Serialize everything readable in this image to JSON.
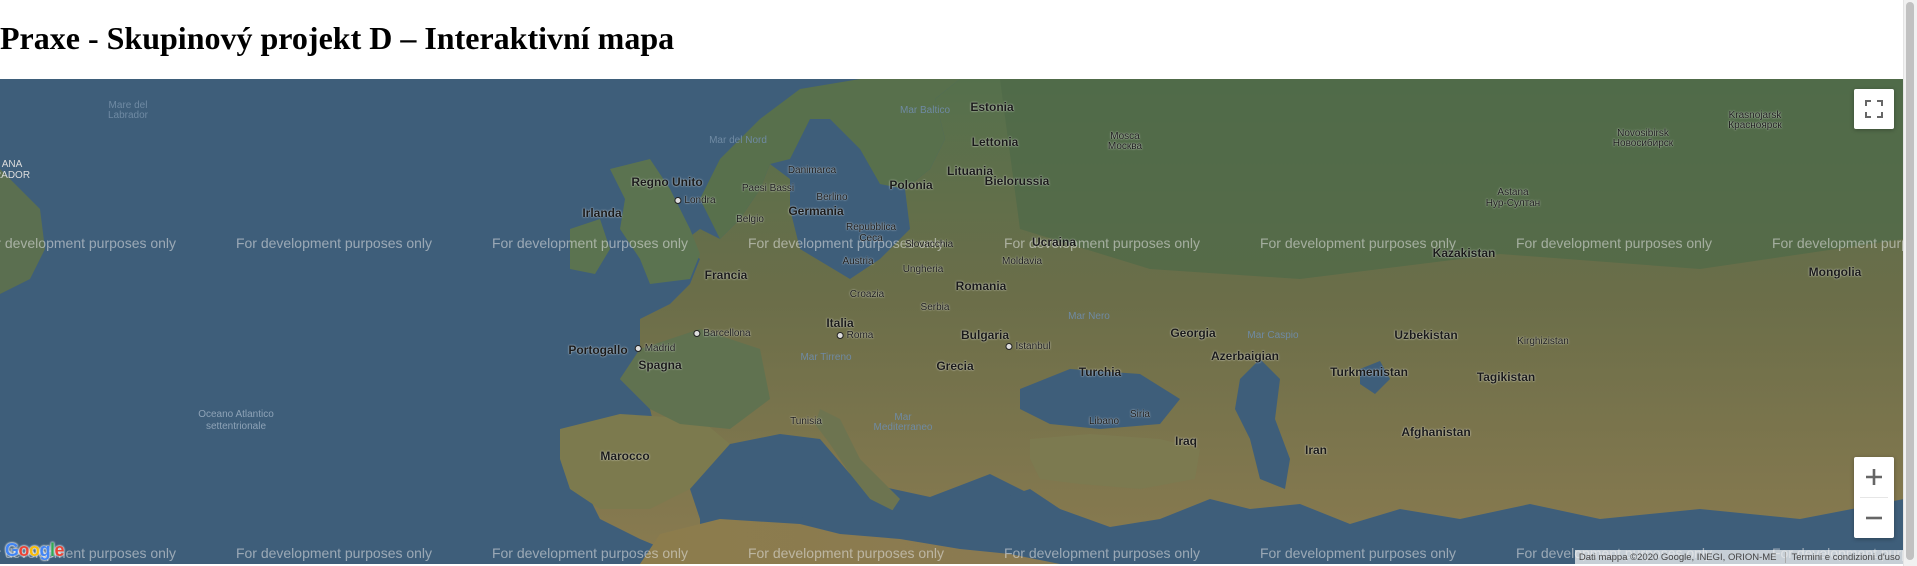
{
  "page": {
    "title": "Praxe - Skupinový projekt D – Interaktivní mapa"
  },
  "map": {
    "watermark": "For development purposes only",
    "attribution": "Dati mappa ©2020 Google, INEGI, ORION-ME",
    "terms": "Termini e condizioni d'uso",
    "logo": "Google",
    "controls": {
      "fullscreen_icon": "fullscreen-icon",
      "zoom_in": "+",
      "zoom_out": "−"
    },
    "colors": {
      "water": "#3e5e7a",
      "land_green": "#5d7350",
      "land_olive": "#6d6f4a",
      "land_desert": "#8b7d52"
    },
    "labels": {
      "estonia": "Estonia",
      "lettonia": "Lettonia",
      "lituania": "Lituania",
      "regno_unito": "Regno Unito",
      "irlanda": "Irlanda",
      "danimarca": "Danimarca",
      "mar_baltico": "Mar Baltico",
      "mar_del_nord": "Mar del Nord",
      "mosca": "Mosca\nМосква",
      "novosibirsk": "Novosibirsk\nНовосибирск",
      "krasnoyarsk": "Krasnojarsk\nКрасноярск",
      "mare_labrador": "Mare del\nLabrador",
      "canada_edge": "ANA\nRADOR",
      "londra": "Londra",
      "paesi_bassi": "Paesi Bassi",
      "berlino": "Berlino",
      "polonia": "Polonia",
      "bielorussia": "Bielorussia",
      "belgio": "Belgio",
      "germania": "Germania",
      "repubblica_ceca": "Repubblica\nCeca",
      "slovacchia": "Slovacchia",
      "ucraina": "Ucraina",
      "astana": "Astana\nНур-Султан",
      "kazakistan": "Kazakistan",
      "mongolia": "Mongolia",
      "austria": "Austria",
      "ungheria": "Ungheria",
      "moldavia": "Moldavia",
      "francia": "Francia",
      "croazia": "Croazia",
      "romania": "Romania",
      "serbia": "Serbia",
      "italia": "Italia",
      "roma": "Roma",
      "bulgaria": "Bulgaria",
      "mar_nero": "Mar Nero",
      "georgia": "Georgia",
      "mar_caspio": "Mar Caspio",
      "uzbekistan": "Uzbekistan",
      "kirghizistan": "Kirghizistan",
      "barcellona": "Barcellona",
      "portogallo": "Portogallo",
      "madrid": "Madrid",
      "spagna": "Spagna",
      "mar_tirreno": "Mar Tirreno",
      "istanbul": "Istanbul",
      "azerbaigian": "Azerbaigian",
      "grecia": "Grecia",
      "turchia": "Turchia",
      "turkmenistan": "Turkmenistan",
      "tagikistan": "Tagikistan",
      "oceano_atlantico": "Oceano Atlantico\nsettentrionale",
      "siria": "Siria",
      "tunisia": "Tunisia",
      "mar_mediterraneo": "Mar\nMediterraneo",
      "libano": "Libano",
      "iraq": "Iraq",
      "afghanistan": "Afghanistan",
      "marocco": "Marocco",
      "iran": "Iran"
    }
  }
}
